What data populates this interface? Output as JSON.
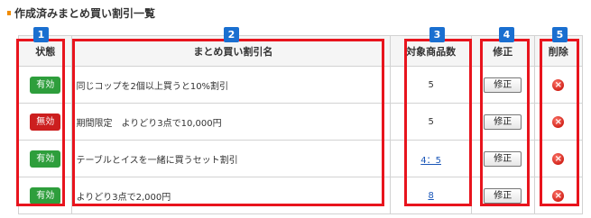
{
  "page_title": "作成済みまとめ買い割引一覧",
  "columns": {
    "status": "状態",
    "name": "まとめ買い割引名",
    "count": "対象商品数",
    "edit": "修正",
    "delete": "削除"
  },
  "callouts": [
    "1",
    "2",
    "3",
    "4",
    "5"
  ],
  "rows": [
    {
      "status": "有効",
      "status_type": "on",
      "name": "同じコップを2個以上買うと10%割引",
      "count": "5",
      "count_link": false,
      "edit": "修正",
      "delete_icon": "delete-icon"
    },
    {
      "status": "無効",
      "status_type": "off",
      "name": "期間限定　よりどり3点で10,000円",
      "count": "5",
      "count_link": false,
      "edit": "修正",
      "delete_icon": "delete-icon"
    },
    {
      "status": "有効",
      "status_type": "on",
      "name": "テーブルとイスを一緒に買うセット割引",
      "count": "4：5",
      "count_link": true,
      "edit": "修正",
      "delete_icon": "delete-icon"
    },
    {
      "status": "有効",
      "status_type": "on",
      "name": "よりどり3点で2,000円",
      "count": "8",
      "count_link": true,
      "edit": "修正",
      "delete_icon": "delete-icon"
    }
  ],
  "colors": {
    "active": "#2e9e3c",
    "inactive": "#cc1f1f",
    "highlight": "#e8141d",
    "callout": "#1a6fd0"
  }
}
